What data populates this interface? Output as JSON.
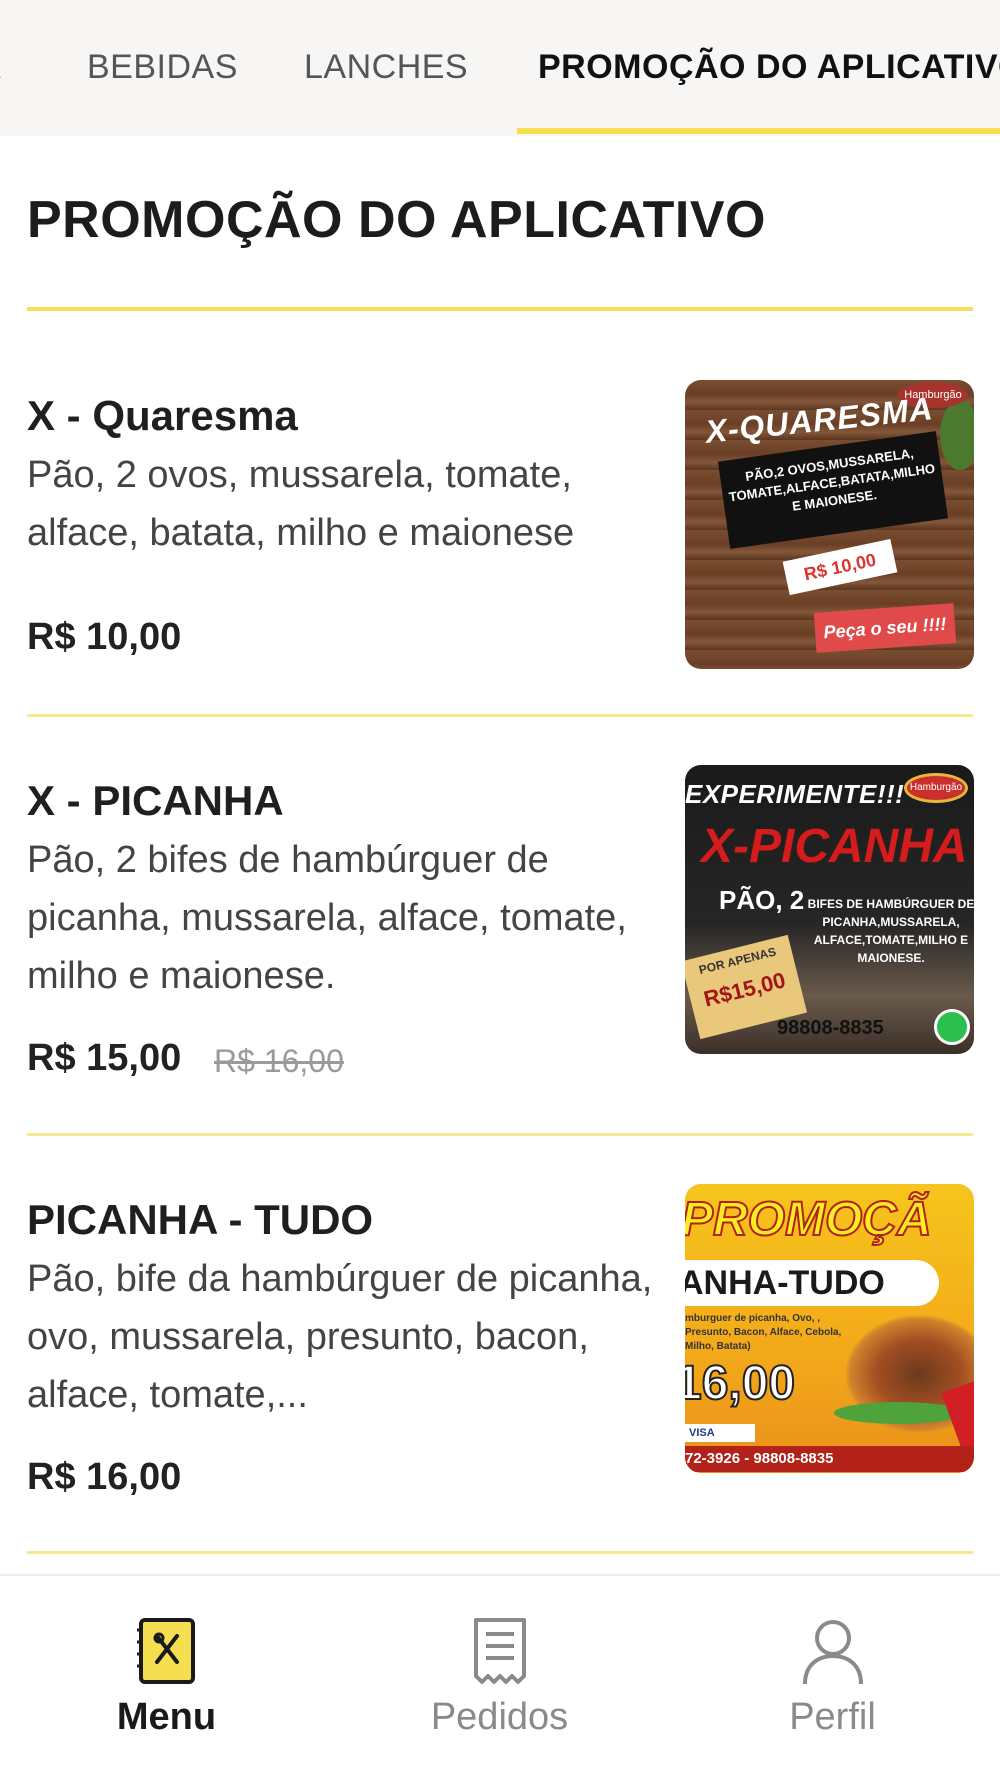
{
  "tabs": [
    {
      "label": "A",
      "active": false
    },
    {
      "label": "BEBIDAS",
      "active": false
    },
    {
      "label": "LANCHES",
      "active": false
    },
    {
      "label": "PROMOÇÃO DO APLICATIVO",
      "active": true
    }
  ],
  "section": {
    "title": "PROMOÇÃO DO APLICATIVO"
  },
  "items": [
    {
      "name": "X - Quaresma",
      "description": "Pão, 2 ovos, mussarela, tomate, alface, batata, milho e maionese",
      "price": "R$ 10,00",
      "old_price": "",
      "image": {
        "banner": "X-QUARESMA",
        "box_text": "PÃO,2 OVOS,MUSSARELA, TOMATE,ALFACE,BATATA,MILHO E MAIONESE.",
        "price_tag": "R$ 10,00",
        "cta": "Peça o seu !!!!",
        "logo": "Hamburgão"
      }
    },
    {
      "name": "X - PICANHA",
      "description": "Pão, 2 bifes de hambúrguer de picanha, mussarela, alface, tomate, milho e maionese.",
      "price": "R$ 15,00",
      "old_price": "R$ 16,00",
      "image": {
        "headline": "EXPERIMENTE!!!",
        "logo": "Hamburgão",
        "title": "X-PICANHA",
        "pao": "PÃO, 2",
        "desc": "BIFES DE HAMBÚRGUER DE PICANHA,MUSSARELA, ALFACE,TOMATE,MILHO E MAIONESE.",
        "ticket_small": "POR APENAS",
        "ticket_price": "R$15,00",
        "phone": "98808-8835"
      }
    },
    {
      "name": "PICANHA - TUDO",
      "description": "Pão, bife da hambúrguer de picanha, ovo, mussarela, presunto, bacon, alface, tomate,...",
      "price": "R$ 16,00",
      "old_price": "",
      "image": {
        "head": "PROMOÇÃ",
        "ribbon": "ANHA-TUDO",
        "small": "mburguer de picanha, Ovo, , Presunto, Bacon, Alface, Cebola, Milho, Batata)",
        "price": "16,00",
        "cards": "VISA",
        "phones": "72-3926 - 98808-8835"
      }
    }
  ],
  "bottom_nav": [
    {
      "label": "Menu",
      "icon": "menu-book-icon",
      "active": true
    },
    {
      "label": "Pedidos",
      "icon": "receipt-icon",
      "active": false
    },
    {
      "label": "Perfil",
      "icon": "person-icon",
      "active": false
    }
  ],
  "colors": {
    "accent": "#f5de4f",
    "divider": "#f7e88f",
    "tab_bar_bg": "#f7f6f4"
  }
}
